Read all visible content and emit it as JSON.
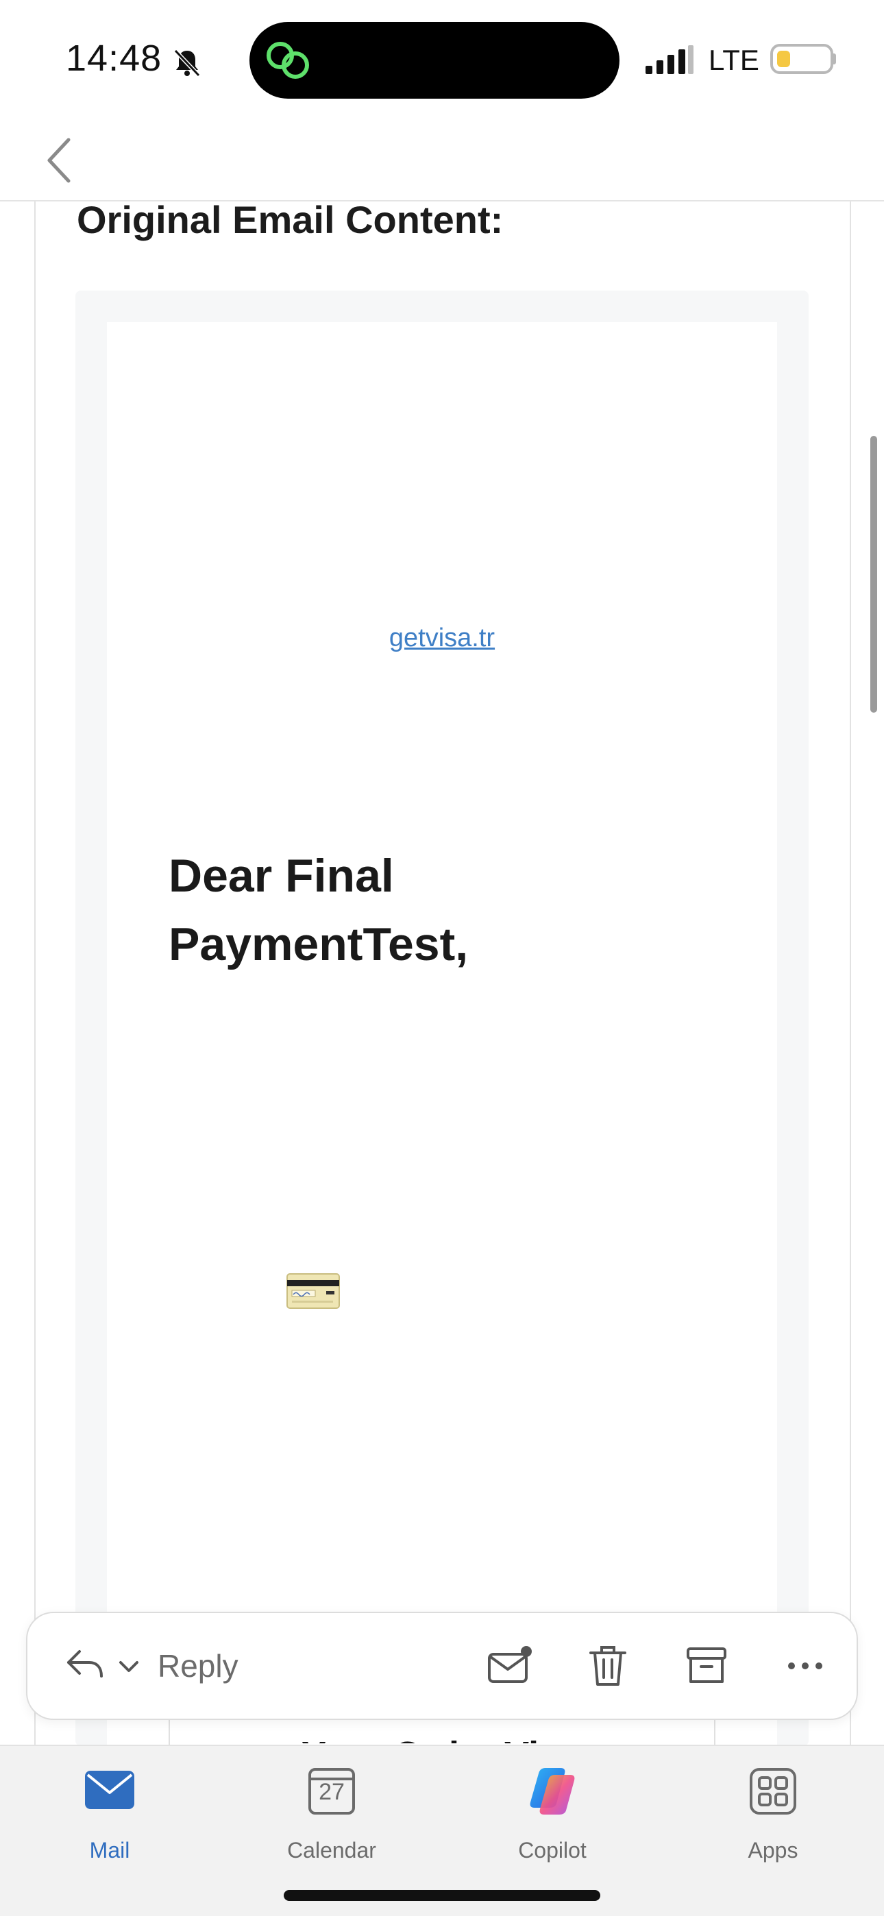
{
  "status_bar": {
    "time": "14:48",
    "network": "LTE",
    "battery_level": 0.25
  },
  "email": {
    "section_title": "Original Email Content:",
    "link_text": "getvisa.tr",
    "greeting": "Dear Final PaymentTest,",
    "table_peek_text": "Your Order Vi"
  },
  "action_bar": {
    "reply_label": "Reply"
  },
  "tabs": [
    {
      "label": "Mail",
      "icon": "mail-icon",
      "active": true
    },
    {
      "label": "Calendar",
      "icon": "calendar-icon",
      "day": "27"
    },
    {
      "label": "Copilot",
      "icon": "copilot-icon"
    },
    {
      "label": "Apps",
      "icon": "apps-icon"
    }
  ],
  "colors": {
    "accent": "#2f6dbf",
    "link": "#3f7fc6",
    "battery": "#f5c842",
    "island_icon": "#5ee06b"
  }
}
